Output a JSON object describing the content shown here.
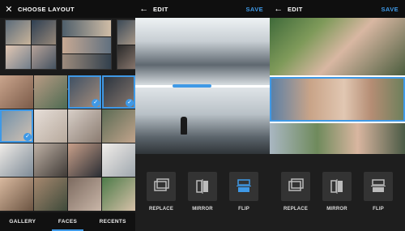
{
  "panel_layout": {
    "title": "CHOOSE LAYOUT",
    "tabs": [
      {
        "label": "GALLERY",
        "active": false
      },
      {
        "label": "FACES",
        "active": true
      },
      {
        "label": "RECENTS",
        "active": false
      }
    ],
    "selected_count": 3
  },
  "panel_edit_1": {
    "title": "EDIT",
    "save_label": "SAVE",
    "tools": [
      {
        "label": "REPLACE",
        "icon": "replace-icon"
      },
      {
        "label": "MIRROR",
        "icon": "mirror-icon"
      },
      {
        "label": "FLIP",
        "icon": "flip-icon",
        "active": true
      }
    ]
  },
  "panel_edit_2": {
    "title": "EDIT",
    "save_label": "SAVE",
    "tools": [
      {
        "label": "REPLACE",
        "icon": "replace-icon"
      },
      {
        "label": "MIRROR",
        "icon": "mirror-icon"
      },
      {
        "label": "FLIP",
        "icon": "flip-icon"
      }
    ]
  },
  "colors": {
    "accent": "#3f99e6",
    "header_bg": "#0f0f0f",
    "panel_bg": "#1b1b1b"
  }
}
